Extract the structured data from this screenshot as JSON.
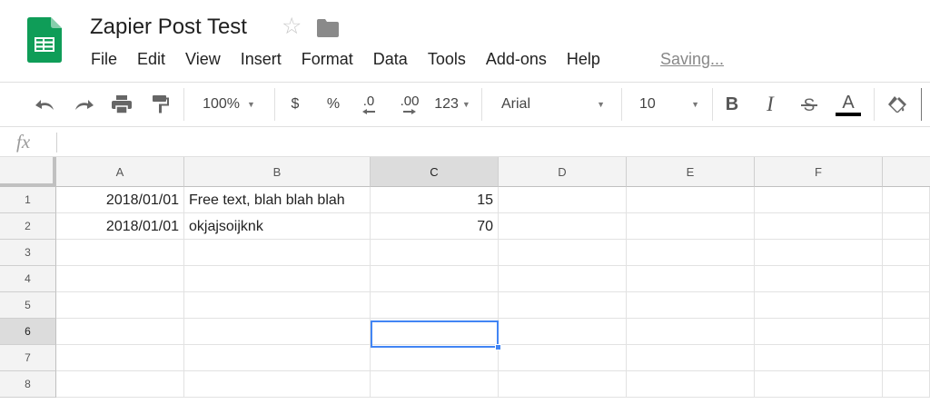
{
  "doc": {
    "title": "Zapier Post Test",
    "saving_status": "Saving..."
  },
  "colors": {
    "sheets_green": "#0f9d58",
    "selection_blue": "#4285f4",
    "header_gray": "#f3f3f3"
  },
  "icons": [
    "sheets-logo-icon",
    "star-icon",
    "folder-icon",
    "undo-icon",
    "redo-icon",
    "print-icon",
    "paint-format-icon",
    "bold-icon",
    "italic-icon",
    "strikethrough-icon",
    "text-color-icon",
    "fill-color-icon"
  ],
  "menu": [
    "File",
    "Edit",
    "View",
    "Insert",
    "Format",
    "Data",
    "Tools",
    "Add-ons",
    "Help"
  ],
  "toolbar": {
    "zoom": "100%",
    "currency": "$",
    "percent": "%",
    "dec_decrease": ".0",
    "dec_increase": ".00",
    "more_formats": "123",
    "font": "Arial",
    "font_size": "10",
    "bold": "B",
    "italic": "I",
    "text_color": "A"
  },
  "formula_bar": {
    "label": "fx",
    "value": ""
  },
  "sheet": {
    "columns": [
      "A",
      "B",
      "C",
      "D",
      "E",
      "F"
    ],
    "rows": [
      "1",
      "2",
      "3",
      "4",
      "5",
      "6",
      "7",
      "8"
    ],
    "selected_cell": "C6",
    "cells": {
      "r1": {
        "a": "2018/01/01",
        "b": "Free text, blah blah blah",
        "c": "15"
      },
      "r2": {
        "a": "2018/01/01",
        "b": "okjajsoijknk",
        "c": "70"
      }
    }
  }
}
